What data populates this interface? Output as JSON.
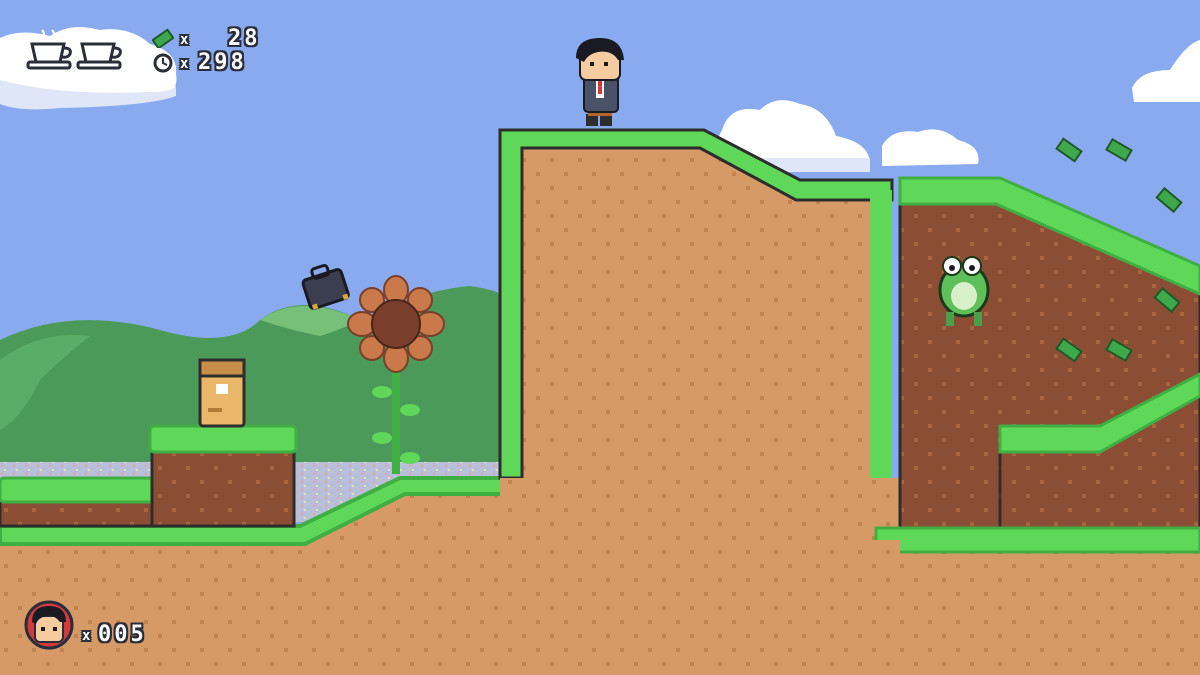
{
  "hud": {
    "health_cups": {
      "count": 2,
      "icon": "coffee-cup-icon"
    },
    "money": {
      "icon": "cash-icon",
      "multiplier": "x",
      "value": "28"
    },
    "timer": {
      "icon": "clock-icon",
      "multiplier": "x",
      "value": "298"
    },
    "lives": {
      "icon": "player-face-icon",
      "multiplier": "x",
      "value": "005"
    }
  },
  "colors": {
    "sky": "#8aaaf0",
    "grass": "#5fd85a",
    "grass_dark": "#3fae43",
    "dirt": "#d69a66",
    "dirt_dark": "#8b4e35",
    "hills": "#4c9a5a",
    "cash": "#3fa84d"
  },
  "scene": {
    "player": "office-worker-character",
    "enemy": "frog-enemy",
    "item_block": "cardboard-box",
    "flying_object": "briefcase",
    "plant": "sunflower"
  }
}
